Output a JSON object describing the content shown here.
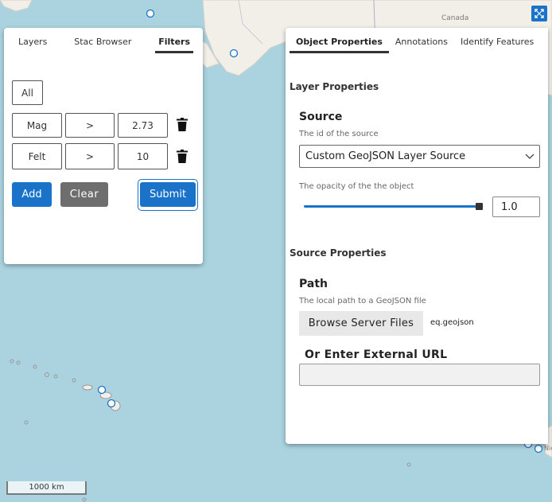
{
  "map": {
    "country_label": "Canada",
    "scale_label": "1000 km",
    "fullscreen_icon": "expand-icon",
    "partial_labels": [
      "Nic"
    ]
  },
  "left_panel": {
    "tabs": [
      {
        "label": "Layers",
        "active": false
      },
      {
        "label": "Stac Browser",
        "active": false
      },
      {
        "label": "Filters",
        "active": true
      }
    ],
    "logical_operator": "All",
    "filters": [
      {
        "field": "Mag",
        "operator": ">",
        "value": "2.73"
      },
      {
        "field": "Felt",
        "operator": ">",
        "value": "10"
      }
    ],
    "add_label": "Add",
    "clear_label": "Clear",
    "submit_label": "Submit"
  },
  "right_panel": {
    "tabs": [
      {
        "label": "Object Properties",
        "active": true
      },
      {
        "label": "Annotations",
        "active": false
      },
      {
        "label": "Identify Features",
        "active": false
      }
    ],
    "layer_properties_title": "Layer Properties",
    "source": {
      "title": "Source",
      "description": "The id of the source",
      "selected": "Custom GeoJSON Layer Source"
    },
    "opacity": {
      "description": "The opacity of the the object",
      "value": "1.0",
      "fraction": 1.0
    },
    "source_properties_title": "Source Properties",
    "path": {
      "title": "Path",
      "description": "The local path to a GeoJSON file",
      "browse_label": "Browse Server Files",
      "file_name": "eq.geojson"
    },
    "external_url": {
      "title": "Or Enter External URL",
      "value": ""
    }
  },
  "colors": {
    "accent": "#1a73c9",
    "water": "#aad3df",
    "land": "#f2efe9",
    "clear_button": "#6e6e6e"
  }
}
